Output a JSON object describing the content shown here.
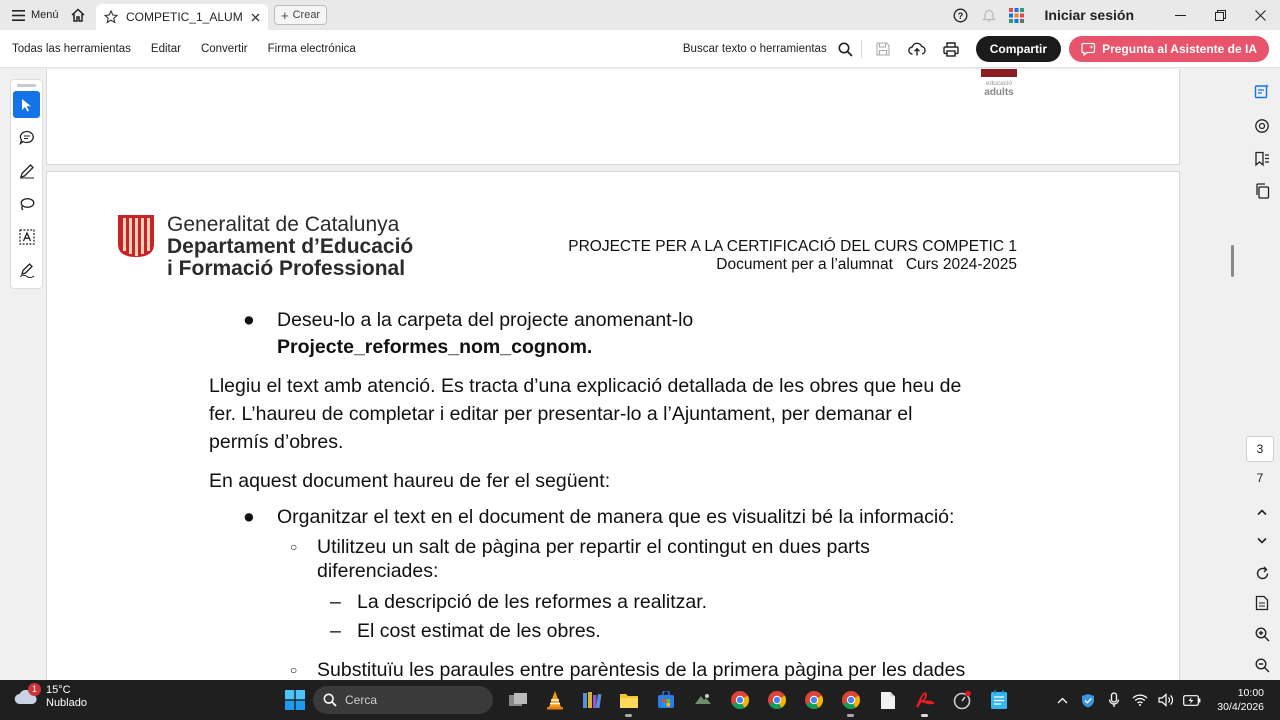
{
  "titlebar": {
    "menu_label": "Menú",
    "tab_title": "COMPETIC_1_ALUM...",
    "new_label": "Crear",
    "signin_label": "Iniciar sesión"
  },
  "toolbar": {
    "menus": [
      "Todas las herramientas",
      "Editar",
      "Convertir",
      "Firma electrónica"
    ],
    "search_label": "Buscar texto o herramientas",
    "share_label": "Compartir",
    "ai_label": "Pregunta al Asistente de IA"
  },
  "document": {
    "logo_small_text": [
      "educació",
      "adults"
    ],
    "org": {
      "line1": "Generalitat de Catalunya",
      "line2": "Departament d’Educació",
      "line3": "i Formació Professional"
    },
    "header_right": {
      "line1": "PROJECTE PER A LA CERTIFICACIÓ DEL CURS COMPETIC 1",
      "line2": "Document per a l’alumnat   Curs 2024-2025"
    },
    "bullet1_line1": "Deseu-lo a la carpeta del projecte anomenant-lo",
    "bullet1_line2": "Projecte_reformes_nom_cognom.",
    "para1_line1": "Llegiu el text amb atenció. Es tracta d’una explicació detallada de les obres que heu de",
    "para1_line2": "fer. L’haureu de completar i editar per presentar-lo a l’Ajuntament, per demanar el",
    "para1_line3": "permís d’obres.",
    "para2": "En aquest document haureu de fer el següent:",
    "bullet2": "Organitzar el text en el document de manera que es visualitzi bé la informació:",
    "sub1_line1": "Utilitzeu un salt de pàgina per repartir el contingut en dues parts",
    "sub1_line2": "diferenciades:",
    "dash1": "La descripció de les reformes a realitzar.",
    "dash2": "El cost estimat de les obres.",
    "sub2": "Substituïu les paraules entre parèntesis de la primera pàgina per les dades"
  },
  "navigation": {
    "current_page": "3",
    "total_pages": "7"
  },
  "taskbar": {
    "weather_temp": "15°C",
    "weather_desc": "Nublado",
    "weather_badge": "1",
    "search_placeholder": "Cerca",
    "time": "10:00",
    "date": "30/4/2026"
  },
  "colors": {
    "accent": "#1473e6",
    "ai_button": "#e7546b",
    "share_button": "#1b1b1b",
    "taskbar": "#1f1f1f"
  }
}
